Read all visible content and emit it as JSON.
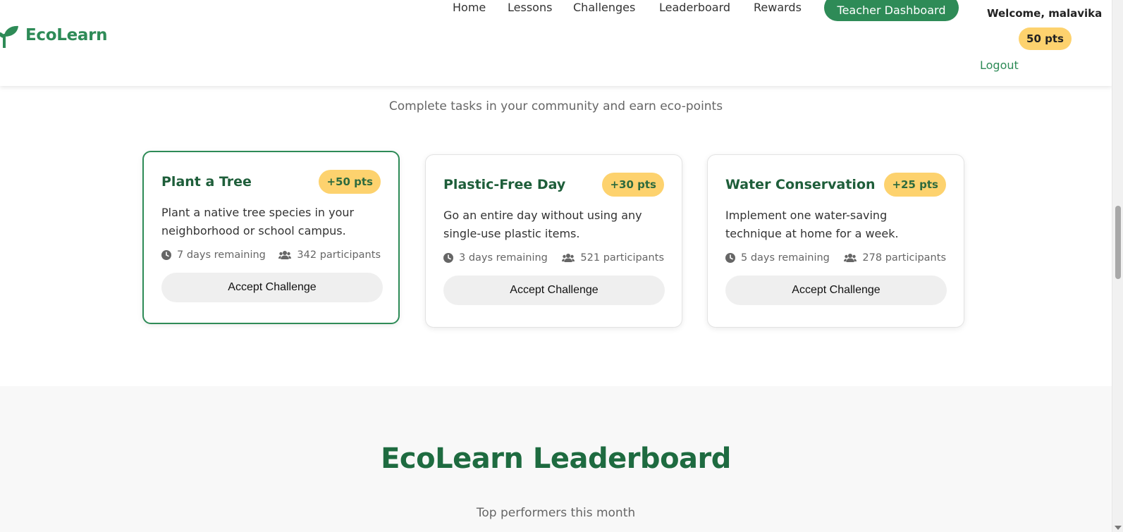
{
  "header": {
    "logo_text": "EcoLearn",
    "nav": [
      "Home",
      "Lessons",
      "Challenges",
      "Leaderboard",
      "Rewards"
    ],
    "teacher_dashboard": "Teacher Dashboard",
    "welcome": "Welcome, malavika",
    "points": "50 pts",
    "logout": "Logout"
  },
  "challenges": {
    "subtitle": "Complete tasks in your community and earn eco-points",
    "cards": [
      {
        "title": "Plant a Tree",
        "points": "+50 pts",
        "description": "Plant a native tree species in your neighborhood or school campus.",
        "remaining": "7 days remaining",
        "participants": "342 participants",
        "button": "Accept Challenge"
      },
      {
        "title": "Plastic-Free Day",
        "points": "+30 pts",
        "description": "Go an entire day without using any single-use plastic items.",
        "remaining": "3 days remaining",
        "participants": "521 participants",
        "button": "Accept Challenge"
      },
      {
        "title": "Water Conservation",
        "points": "+25 pts",
        "description": "Implement one water-saving technique at home for a week.",
        "remaining": "5 days remaining",
        "participants": "278 participants",
        "button": "Accept Challenge"
      }
    ]
  },
  "leaderboard": {
    "title": "EcoLearn Leaderboard",
    "subtitle": "Top performers this month"
  },
  "colors": {
    "brand": "#2e8b57",
    "accent": "#fdd26e",
    "heading": "#1e5e3a"
  },
  "icons": {
    "logo": "sprout-icon",
    "time": "clock-icon",
    "people": "users-icon"
  }
}
